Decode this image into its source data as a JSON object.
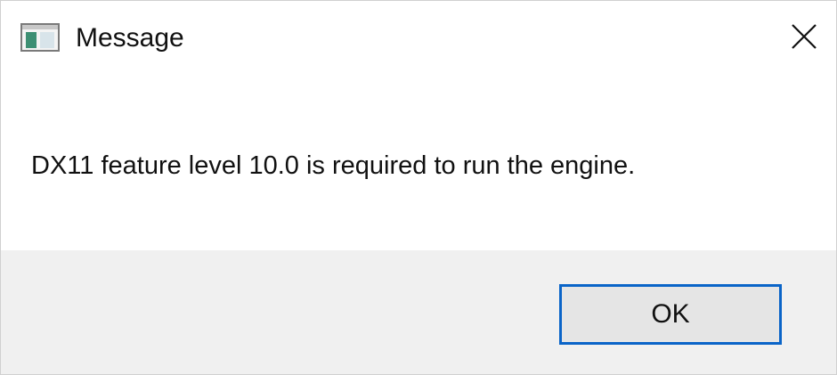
{
  "window": {
    "title": "Message",
    "icon": "app-window-icon",
    "close_icon": "close-icon"
  },
  "message": {
    "text": "DX11 feature level 10.0 is required to run the engine."
  },
  "buttons": {
    "ok_label": "OK"
  },
  "colors": {
    "footer_background": "#f0f0f0",
    "button_border_accent": "#0a64c8",
    "button_background": "#e5e5e5"
  }
}
